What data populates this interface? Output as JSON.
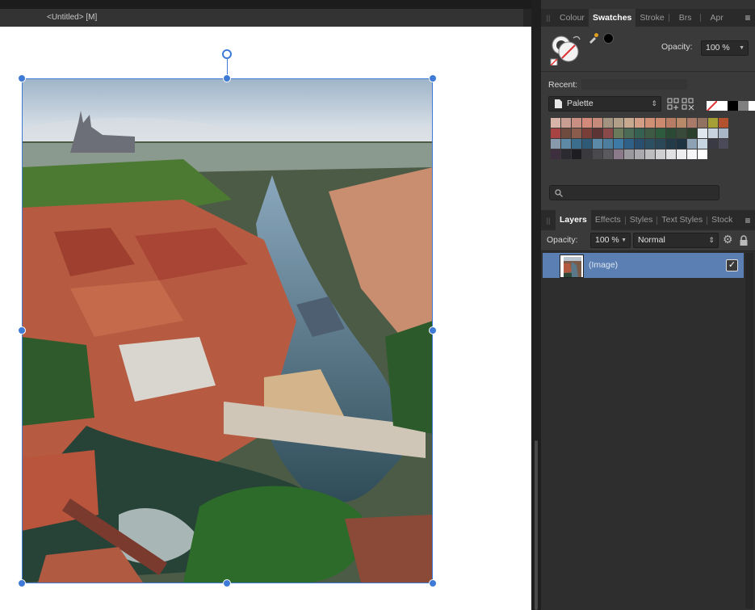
{
  "document": {
    "tab_title": "<Untitled> [M]"
  },
  "swatches_panel": {
    "tabs": [
      {
        "label": "Colour",
        "active": false
      },
      {
        "label": "Swatches",
        "active": true
      },
      {
        "label": "Stroke",
        "active": false
      },
      {
        "label": "Brs",
        "active": false
      },
      {
        "label": "Apr",
        "active": false
      }
    ],
    "opacity_label": "Opacity:",
    "opacity_value": "100 %",
    "recent_label": "Recent:",
    "palette_name": "Palette",
    "quick_colors": [
      "#ffffff",
      "#000000",
      "#808080",
      "#ffffff"
    ],
    "palette_colors": [
      "#d8b3a8",
      "#c89d92",
      "#c98f82",
      "#d48a7a",
      "#c58a7a",
      "#a39482",
      "#b19f89",
      "#c7a98f",
      "#d29f86",
      "#cf8f74",
      "#cb8a6f",
      "#b67d64",
      "#b88969",
      "#a9796a",
      "#917160",
      "#a59f35",
      "#b2522f",
      "#a74343",
      "#6e4a3f",
      "#8b5c4c",
      "#7a3e38",
      "#5c3434",
      "#8a4a4a",
      "#6a7a5a",
      "#4c6b57",
      "#356052",
      "#3e5a44",
      "#2e5a3e",
      "#2a4a35",
      "#3a4a3a",
      "#2c3e2c",
      "#dfe6ee",
      "#c8d3df",
      "#a9b6c5",
      "#8899ab",
      "#5f8aa5",
      "#3b6e8c",
      "#2f5a76",
      "#5a8aa8",
      "#4e7e9d",
      "#3d7aa5",
      "#2e6088",
      "#294e6e",
      "#2c5062",
      "#2b4858",
      "#233a49",
      "#1e3442",
      "#8da3b5",
      "#c7d5e2",
      "#3a3a45",
      "#4a4a58",
      "#3e2f3e",
      "#2a2a30",
      "#1e1e22",
      "#3a3a3e",
      "#4a4a4e",
      "#5a5a5e",
      "#8a7a8a",
      "#9a9a9e",
      "#aaaaae",
      "#bdbdc0",
      "#cfcfd2",
      "#e1e1e4",
      "#ededf0",
      "#f6f6f8",
      "#ffffff"
    ]
  },
  "layers_panel": {
    "tabs": [
      {
        "label": "Layers",
        "active": true
      },
      {
        "label": "Effects",
        "active": false
      },
      {
        "label": "Styles",
        "active": false
      },
      {
        "label": "Text Styles",
        "active": false
      },
      {
        "label": "Stock",
        "active": false
      }
    ],
    "opacity_label": "Opacity:",
    "opacity_value": "100 %",
    "blend_mode": "Normal",
    "layers": [
      {
        "name": "(Image)",
        "visible": true,
        "selected": true
      }
    ]
  }
}
